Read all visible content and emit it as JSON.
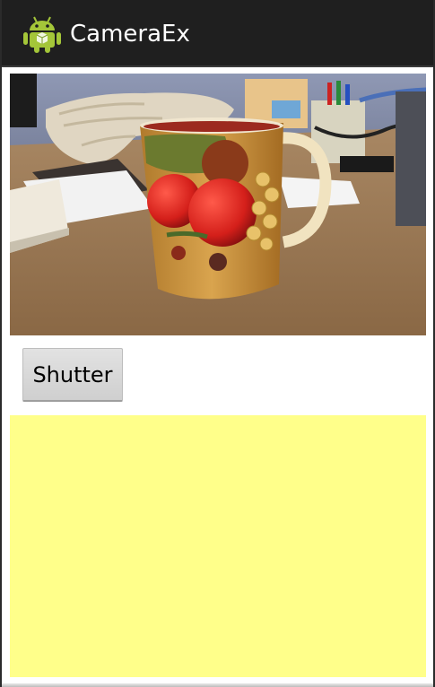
{
  "app": {
    "title": "CameraEx",
    "icon": "android-robot-icon"
  },
  "controls": {
    "shutter_label": "Shutter"
  },
  "colors": {
    "action_bar": "#1f1f1f",
    "captured_background": "#ffff8a",
    "button_background": "#d6d6d6"
  }
}
